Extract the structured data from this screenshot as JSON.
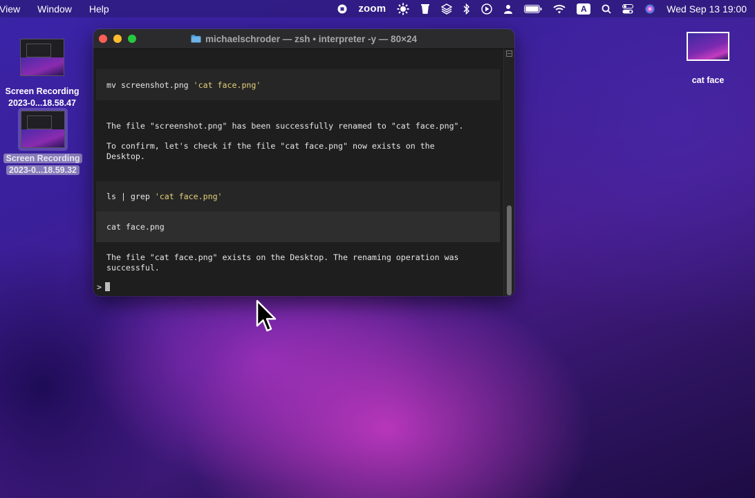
{
  "menubar": {
    "menus": [
      "View",
      "Window",
      "Help"
    ],
    "status": {
      "zoom_label": "zoom",
      "input_badge": "A",
      "clock": "Wed Sep 13  19:00"
    }
  },
  "desktop": {
    "items": [
      {
        "label_line1": "Screen Recording",
        "label_line2": "2023-0...18.58.47"
      },
      {
        "label_line1": "Screen Recording",
        "label_line2": "2023-0...18.59.32"
      },
      {
        "label": "cat face"
      }
    ]
  },
  "terminal": {
    "title": "michaelschroder — zsh • interpreter -y — 80×24",
    "cmd1_plain": "mv screenshot.png ",
    "cmd1_string": "'cat face.png'",
    "msg1": "The file \"screenshot.png\" has been successfully renamed to \"cat face.png\".",
    "msg2_line1": "To confirm, let's check if the file \"cat face.png\" now exists on the",
    "msg2_line2": "Desktop.",
    "cmd2_plain": "ls | grep ",
    "cmd2_string": "'cat face.png'",
    "output": "cat face.png",
    "msg3_line1": "The file \"cat face.png\" exists on the Desktop. The renaming operation was",
    "msg3_line2": "successful.",
    "prompt": ">"
  },
  "colors": {
    "string_literal": "#e6cf7a",
    "close": "#ff5f57",
    "minimize": "#febc2e",
    "maximize": "#28c840"
  }
}
